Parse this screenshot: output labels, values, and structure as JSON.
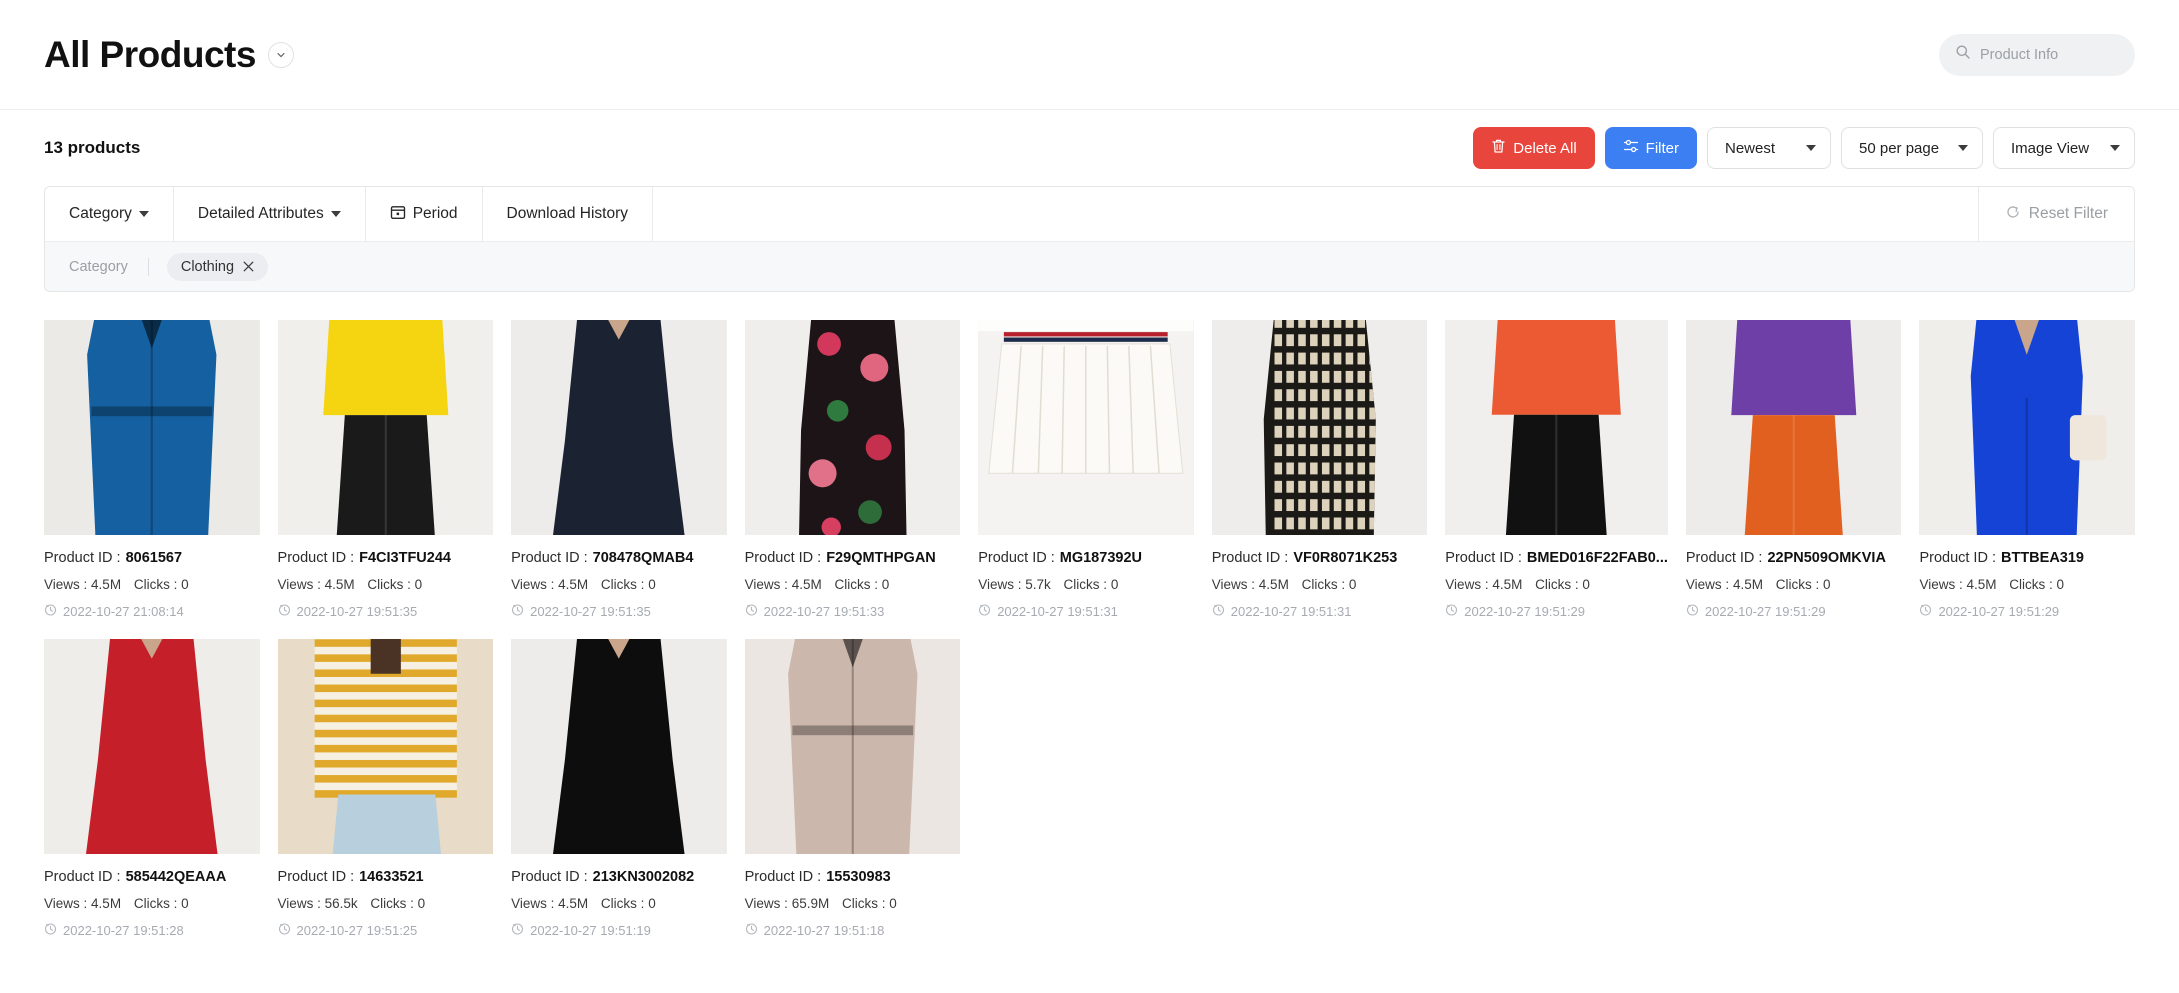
{
  "header": {
    "title": "All Products",
    "title_caret_icon": "chevron-down-icon",
    "search": {
      "icon": "search-icon",
      "placeholder": "Product Info",
      "value": ""
    }
  },
  "toolbar": {
    "product_count": "13 products",
    "delete_all_label": "Delete All",
    "delete_all_icon": "trash-icon",
    "filter_label": "Filter",
    "filter_icon": "sliders-icon",
    "sort_value": "Newest",
    "page_size_value": "50 per page",
    "view_mode_value": "Image View"
  },
  "filter_panel": {
    "tabs": [
      {
        "label": "Category",
        "has_caret": true,
        "icon": null
      },
      {
        "label": "Detailed Attributes",
        "has_caret": true,
        "icon": null
      },
      {
        "label": "Period",
        "has_caret": false,
        "icon": "calendar-icon"
      },
      {
        "label": "Download History",
        "has_caret": false,
        "icon": null
      }
    ],
    "reset_label": "Reset Filter",
    "reset_icon": "refresh-icon",
    "chip_group_label": "Category",
    "chips": [
      {
        "label": "Clothing",
        "remove_icon": "close-icon"
      }
    ]
  },
  "labels": {
    "product_id": "Product ID :",
    "views": "Views :",
    "clicks": "Clicks :",
    "clock_icon": "clock-icon"
  },
  "colors": {
    "danger": "#e8453c",
    "primary": "#3b7ff3",
    "chip_bg": "#ebedf0",
    "muted_text": "#a7abb1"
  },
  "products": [
    {
      "product_id": "8061567",
      "views": "4.5M",
      "clicks": "0",
      "timestamp": "2022-10-27 21:08:14",
      "thumb": {
        "name": "blue-trench-coat",
        "bg": "#eceae7",
        "garment": "#1560a0",
        "lower": "#1560a0",
        "style": "coat"
      }
    },
    {
      "product_id": "F4CI3TFU244",
      "views": "4.5M",
      "clicks": "0",
      "timestamp": "2022-10-27 19:51:35",
      "thumb": {
        "name": "yellow-blazer-black-pants",
        "bg": "#f1efec",
        "garment": "#f5d512",
        "lower": "#1a1a1a",
        "style": "top-bottom"
      }
    },
    {
      "product_id": "708478QMAB4",
      "views": "4.5M",
      "clicks": "0",
      "timestamp": "2022-10-27 19:51:35",
      "thumb": {
        "name": "navy-studded-dress",
        "bg": "#eeecea",
        "garment": "#1b2333",
        "lower": "#1b2333",
        "style": "dress"
      }
    },
    {
      "product_id": "F29QMTHPGAN",
      "views": "4.5M",
      "clicks": "0",
      "timestamp": "2022-10-27 19:51:33",
      "thumb": {
        "name": "floral-print-outfit",
        "bg": "#f0eeec",
        "garment": "#1d1417",
        "lower": "#1d1417",
        "style": "floral"
      }
    },
    {
      "product_id": "MG187392U",
      "views": "5.7k",
      "clicks": "0",
      "timestamp": "2022-10-27 19:51:31",
      "thumb": {
        "name": "white-pleated-skirt",
        "bg": "#f4f3f1",
        "garment": "#fbfaf6",
        "lower": "#fbfaf6",
        "style": "skirt"
      }
    },
    {
      "product_id": "VF0R8071K253",
      "views": "4.5M",
      "clicks": "0",
      "timestamp": "2022-10-27 19:51:31",
      "thumb": {
        "name": "monogram-print-dress",
        "bg": "#efedeb",
        "garment": "#1c1a16",
        "lower": "#1c1a16",
        "style": "monogram"
      }
    },
    {
      "product_id": "BMED016F22FAB0...",
      "views": "4.5M",
      "clicks": "0",
      "timestamp": "2022-10-27 19:51:29",
      "thumb": {
        "name": "orange-puffer-jacket",
        "bg": "#f1efed",
        "garment": "#ec5a33",
        "lower": "#111111",
        "style": "top-bottom"
      }
    },
    {
      "product_id": "22PN509OMKVIA",
      "views": "4.5M",
      "clicks": "0",
      "timestamp": "2022-10-27 19:51:29",
      "thumb": {
        "name": "purple-orange-outfit",
        "bg": "#eeecea",
        "garment": "#6f3fa8",
        "lower": "#e2601f",
        "style": "top-bottom"
      }
    },
    {
      "product_id": "BTTBEA319",
      "views": "4.5M",
      "clicks": "0",
      "timestamp": "2022-10-27 19:51:29",
      "thumb": {
        "name": "blue-suit-with-bag",
        "bg": "#f0eeeb",
        "garment": "#1543d6",
        "lower": "#1543d6",
        "style": "suit"
      }
    },
    {
      "product_id": "585442QEAAA",
      "views": "4.5M",
      "clicks": "0",
      "timestamp": "2022-10-27 19:51:28",
      "thumb": {
        "name": "red-wrap-dress",
        "bg": "#efedea",
        "garment": "#c5202a",
        "lower": "#c5202a",
        "style": "dress"
      }
    },
    {
      "product_id": "14633521",
      "views": "56.5k",
      "clicks": "0",
      "timestamp": "2022-10-27 19:51:25",
      "thumb": {
        "name": "yellow-striped-shirt-jeans",
        "bg": "#e8dcc8",
        "garment": "#e0a92c",
        "lower": "#b8cfdd",
        "style": "striped"
      }
    },
    {
      "product_id": "213KN3002082",
      "views": "4.5M",
      "clicks": "0",
      "timestamp": "2022-10-27 19:51:19",
      "thumb": {
        "name": "black-midi-dress",
        "bg": "#eeecea",
        "garment": "#0d0d0d",
        "lower": "#0d0d0d",
        "style": "dress"
      }
    },
    {
      "product_id": "15530983",
      "views": "65.9M",
      "clicks": "0",
      "timestamp": "2022-10-27 19:51:18",
      "thumb": {
        "name": "beige-coat-black-top",
        "bg": "#ece6e2",
        "garment": "#cbb7ab",
        "lower": "#cbb7ab",
        "style": "coat"
      }
    }
  ]
}
